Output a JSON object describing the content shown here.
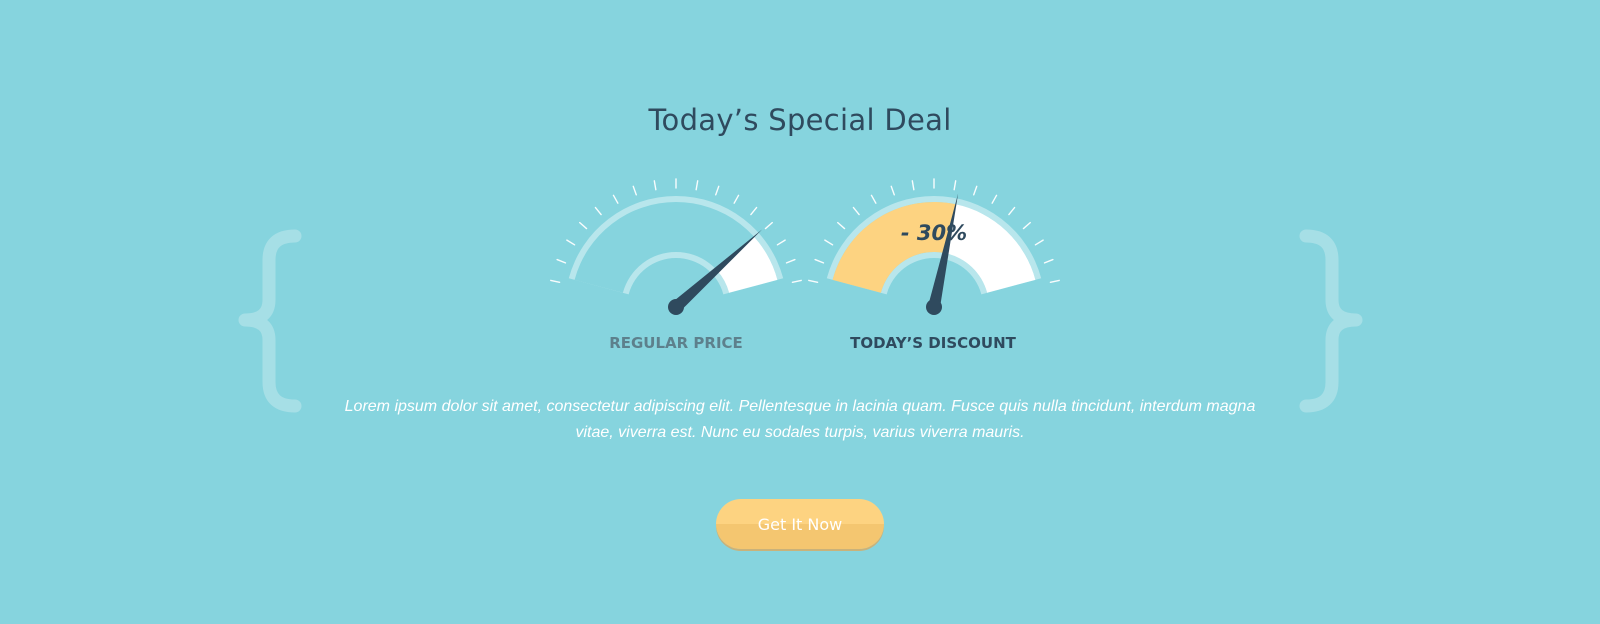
{
  "header": {
    "title": "Today’s Special Deal"
  },
  "gauges": [
    {
      "label": "REGULAR PRICE",
      "value_fraction": 0.82
    },
    {
      "label": "TODAY’S DISCOUNT",
      "value_fraction": 0.58,
      "badge": "- 30%"
    }
  ],
  "description": "Lorem ipsum dolor sit amet, consectetur adipiscing elit. Pellentesque in lacinia quam. Fusce quis nulla tincidunt, interdum magna vitae, viverra est. Nunc eu sodales turpis, varius viverra mauris.",
  "cta": {
    "label": "Get It Now"
  },
  "colors": {
    "background": "#86d4de",
    "title": "#2f4a5e",
    "accent": "#fdd381",
    "needle": "#2f4a5e",
    "gauge_ring": "#b8e6ec"
  },
  "icons": {
    "left_brace": "curly-brace-left-icon",
    "right_brace": "curly-brace-right-icon"
  }
}
